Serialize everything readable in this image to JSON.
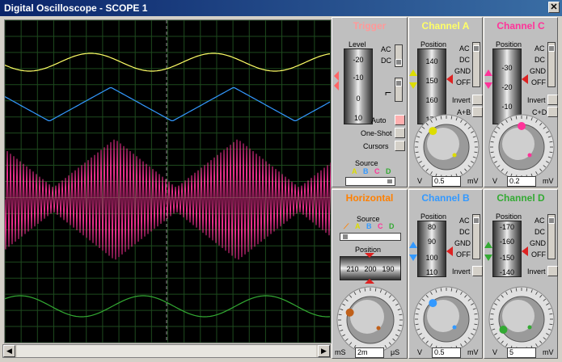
{
  "window": {
    "title": "Digital Oscilloscope - SCOPE 1",
    "close_label": "✕"
  },
  "colors": {
    "chA": "#ffff66",
    "chB": "#3399ff",
    "chC": "#ff3399",
    "chD": "#33aa33",
    "trigger_title": "#ff9999",
    "horizontal_title": "#ff8000"
  },
  "trigger": {
    "title": "Trigger",
    "level_label": "Level",
    "level_ticks": [
      "-20",
      "-10",
      "0",
      "10"
    ],
    "ac": "AC",
    "dc": "DC",
    "auto": "Auto",
    "oneshot": "One-Shot",
    "cursors": "Cursors",
    "source_label": "Source",
    "sources": [
      "A",
      "B",
      "C",
      "D"
    ]
  },
  "channel_a": {
    "title": "Channel A",
    "position_label": "Position",
    "ticks": [
      "140",
      "150",
      "160",
      "170"
    ],
    "ac": "AC",
    "dc": "DC",
    "gnd": "GND",
    "off": "OFF",
    "invert": "Invert",
    "combine": "A+B",
    "dial_left": "V",
    "dial_value": "0.5",
    "dial_unit": "mV",
    "scale": [
      "0.1",
      "0.2",
      "0.5",
      "1",
      "2",
      "5",
      "10",
      "20",
      "50",
      "20",
      "10",
      "5",
      "2",
      "1",
      "0.5"
    ]
  },
  "channel_b": {
    "title": "Channel B",
    "position_label": "Position",
    "ticks": [
      "80",
      "90",
      "100",
      "110"
    ],
    "ac": "AC",
    "dc": "DC",
    "gnd": "GND",
    "off": "OFF",
    "invert": "Invert",
    "dial_left": "V",
    "dial_value": "0.5",
    "dial_unit": "mV",
    "scale": [
      "0.1",
      "0.2",
      "0.5",
      "1",
      "2",
      "5",
      "10",
      "20",
      "50",
      "20",
      "10",
      "5",
      "2",
      "1",
      "0.5"
    ]
  },
  "channel_c": {
    "title": "Channel C",
    "position_label": "Position",
    "ticks": [
      "-30",
      "-20",
      "-10"
    ],
    "ac": "AC",
    "dc": "DC",
    "gnd": "GND",
    "off": "OFF",
    "invert": "Invert",
    "combine": "C+D",
    "dial_left": "V",
    "dial_value": "0.2",
    "dial_unit": "mV",
    "scale": [
      "0.1",
      "0.2",
      "0.5",
      "1",
      "2",
      "5",
      "10",
      "20",
      "50",
      "20",
      "10",
      "5",
      "2",
      "1",
      "0.5"
    ]
  },
  "channel_d": {
    "title": "Channel D",
    "position_label": "Position",
    "ticks": [
      "-170",
      "-160",
      "-150",
      "-140"
    ],
    "ac": "AC",
    "dc": "DC",
    "gnd": "GND",
    "off": "OFF",
    "invert": "Invert",
    "dial_left": "V",
    "dial_value": "5",
    "dial_unit": "mV",
    "scale": [
      "0.1",
      "0.2",
      "0.5",
      "1",
      "2",
      "5",
      "10",
      "20",
      "50",
      "20",
      "10",
      "5",
      "2",
      "1",
      "0.5"
    ]
  },
  "horizontal": {
    "title": "Horizontal",
    "source_label": "Source",
    "sources": [
      "A",
      "B",
      "C",
      "D"
    ],
    "position_label": "Position",
    "position_ticks": [
      "210",
      "200",
      "190"
    ],
    "dial_left": "mS",
    "dial_value": "2m",
    "dial_unit": "μS",
    "scale": [
      "0.5",
      "1",
      "2",
      "5",
      "10",
      "20",
      "50",
      "100",
      "200",
      "0.5",
      "1",
      "2",
      "5",
      "10",
      "20",
      "50",
      "100",
      "200"
    ]
  }
}
